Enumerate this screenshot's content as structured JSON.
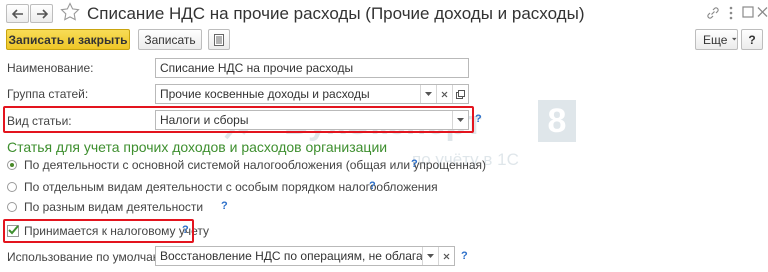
{
  "window": {
    "title": "Списание НДС на прочие расходы (Прочие доходы и расходы)",
    "star_icon": "star-outline-icon",
    "link_icon": "link-icon",
    "more_icon": "more-vertical-icon",
    "maximize_icon": "maximize-icon",
    "close_icon": "close-icon"
  },
  "toolbar": {
    "save_close_label": "Записать и закрыть",
    "save_label": "Записать",
    "more_label": "Еще",
    "help_label": "?"
  },
  "form": {
    "name_label": "Наименование:",
    "name_value": "Списание НДС на прочие расходы",
    "group_label": "Группа статей:",
    "group_value": "Прочие косвенные доходы и расходы",
    "type_label": "Вид статьи:",
    "type_value": "Налоги и сборы",
    "section_title": "Статья для учета прочих доходов и расходов организации",
    "radio_options": [
      "По деятельности с основной системой налогообложения (общая или упрощенная)",
      "По отдельным видам деятельности с особым порядком налогообложения",
      "По разным видам деятельности"
    ],
    "selected_radio": 0,
    "tax_checkbox_label": "Принимается к налоговому учету",
    "tax_checkbox_checked": true,
    "default_label": "Использование по умолчанию:",
    "default_value": "Восстановление НДС по операциям, не облагаемым налогом"
  },
  "watermark": {
    "brand": "БухЭксперт",
    "number": "8",
    "tagline": "по учёту в 1С"
  },
  "colors": {
    "accent_yellow": "#f5d13a",
    "section_green": "#3e8f2f",
    "highlight_red": "#e3141e",
    "help_blue": "#2c6fc9"
  }
}
